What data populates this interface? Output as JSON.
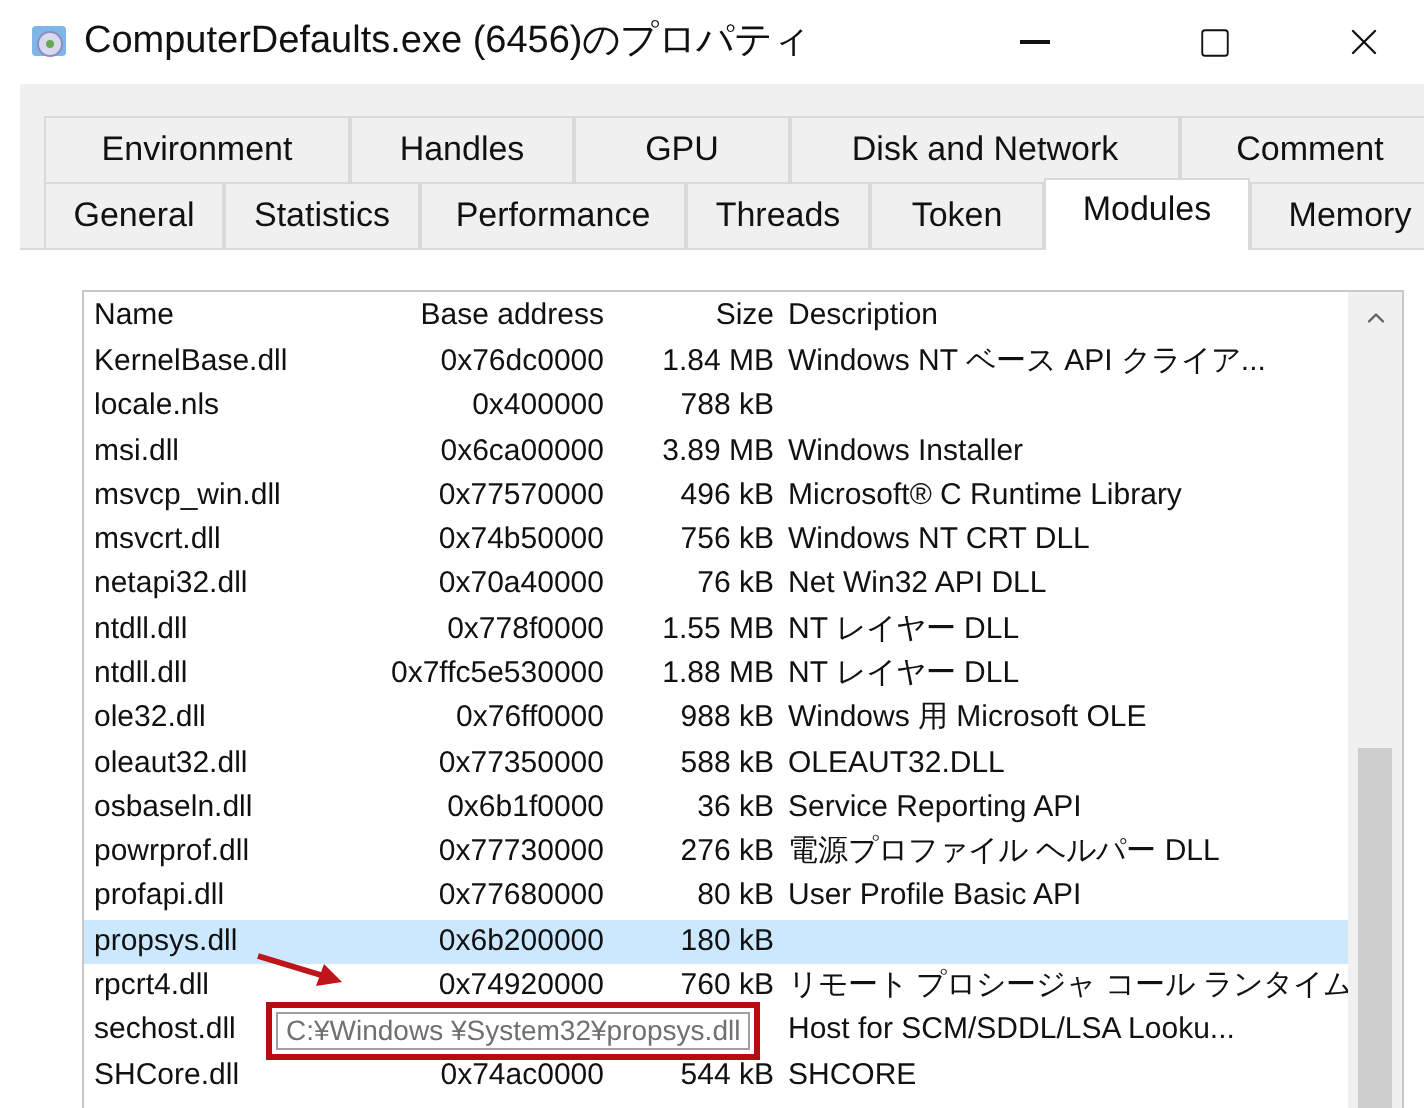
{
  "window": {
    "title": "ComputerDefaults.exe (6456)のプロパティ"
  },
  "tab_rows": [
    [
      {
        "label": "Environment",
        "selected": false
      },
      {
        "label": "Handles",
        "selected": false
      },
      {
        "label": "GPU",
        "selected": false
      },
      {
        "label": "Disk and Network",
        "selected": false
      },
      {
        "label": "Comment",
        "selected": false
      }
    ],
    [
      {
        "label": "General",
        "selected": false
      },
      {
        "label": "Statistics",
        "selected": false
      },
      {
        "label": "Performance",
        "selected": false
      },
      {
        "label": "Threads",
        "selected": false
      },
      {
        "label": "Token",
        "selected": false
      },
      {
        "label": "Modules",
        "selected": true
      },
      {
        "label": "Memory",
        "selected": false
      }
    ]
  ],
  "table": {
    "columns": [
      "Name",
      "Base address",
      "Size",
      "Description"
    ],
    "rows": [
      {
        "name": "KernelBase.dll",
        "base_address": "0x76dc0000",
        "size": "1.84 MB",
        "description": "Windows NT ベース API クライア...",
        "selected": false
      },
      {
        "name": "locale.nls",
        "base_address": "0x400000",
        "size": "788 kB",
        "selected": false
      },
      {
        "name": "msi.dll",
        "base_address": "0x6ca00000",
        "size": "3.89 MB",
        "description": "Windows Installer",
        "selected": false
      },
      {
        "name": "msvcp_win.dll",
        "base_address": "0x77570000",
        "size": "496 kB",
        "description": "Microsoft® C Runtime Library",
        "selected": false
      },
      {
        "name": "msvcrt.dll",
        "base_address": "0x74b50000",
        "size": "756 kB",
        "description": "Windows NT CRT DLL",
        "selected": false
      },
      {
        "name": "netapi32.dll",
        "base_address": "0x70a40000",
        "size": "76 kB",
        "description": "Net Win32 API DLL",
        "selected": false
      },
      {
        "name": "ntdll.dll",
        "base_address": "0x778f0000",
        "size": "1.55 MB",
        "description": "NT レイヤー DLL",
        "selected": false
      },
      {
        "name": "ntdll.dll",
        "base_address": "0x7ffc5e530000",
        "size": "1.88 MB",
        "description": "NT レイヤー DLL",
        "selected": false
      },
      {
        "name": "ole32.dll",
        "base_address": "0x76ff0000",
        "size": "988 kB",
        "description": "Windows 用 Microsoft OLE",
        "selected": false
      },
      {
        "name": "oleaut32.dll",
        "base_address": "0x77350000",
        "size": "588 kB",
        "description": "OLEAUT32.DLL",
        "selected": false
      },
      {
        "name": "osbaseln.dll",
        "base_address": "0x6b1f0000",
        "size": "36 kB",
        "description": "Service Reporting API",
        "selected": false
      },
      {
        "name": "powrprof.dll",
        "base_address": "0x77730000",
        "size": "276 kB",
        "description": "電源プロファイル ヘルパー DLL",
        "selected": false
      },
      {
        "name": "profapi.dll",
        "base_address": "0x77680000",
        "size": "80 kB",
        "description": "User Profile Basic API",
        "selected": false
      },
      {
        "name": "propsys.dll",
        "base_address": "0x6b200000",
        "size": "180 kB",
        "selected": true
      },
      {
        "name": "rpcrt4.dll",
        "base_address": "0x74920000",
        "size": "760 kB",
        "description": "リモート プロシージャ コール ランタイム",
        "selected": false
      },
      {
        "name": "sechost.dll",
        "description": "Host for SCM/SDDL/LSA Looku...",
        "selected": false
      },
      {
        "name": "SHCore.dll",
        "base_address": "0x74ac0000",
        "size": "544 kB",
        "description": "SHCORE",
        "selected": false
      }
    ]
  },
  "tooltip": {
    "text": "C:¥Windows ¥System32¥propsys.dll"
  }
}
